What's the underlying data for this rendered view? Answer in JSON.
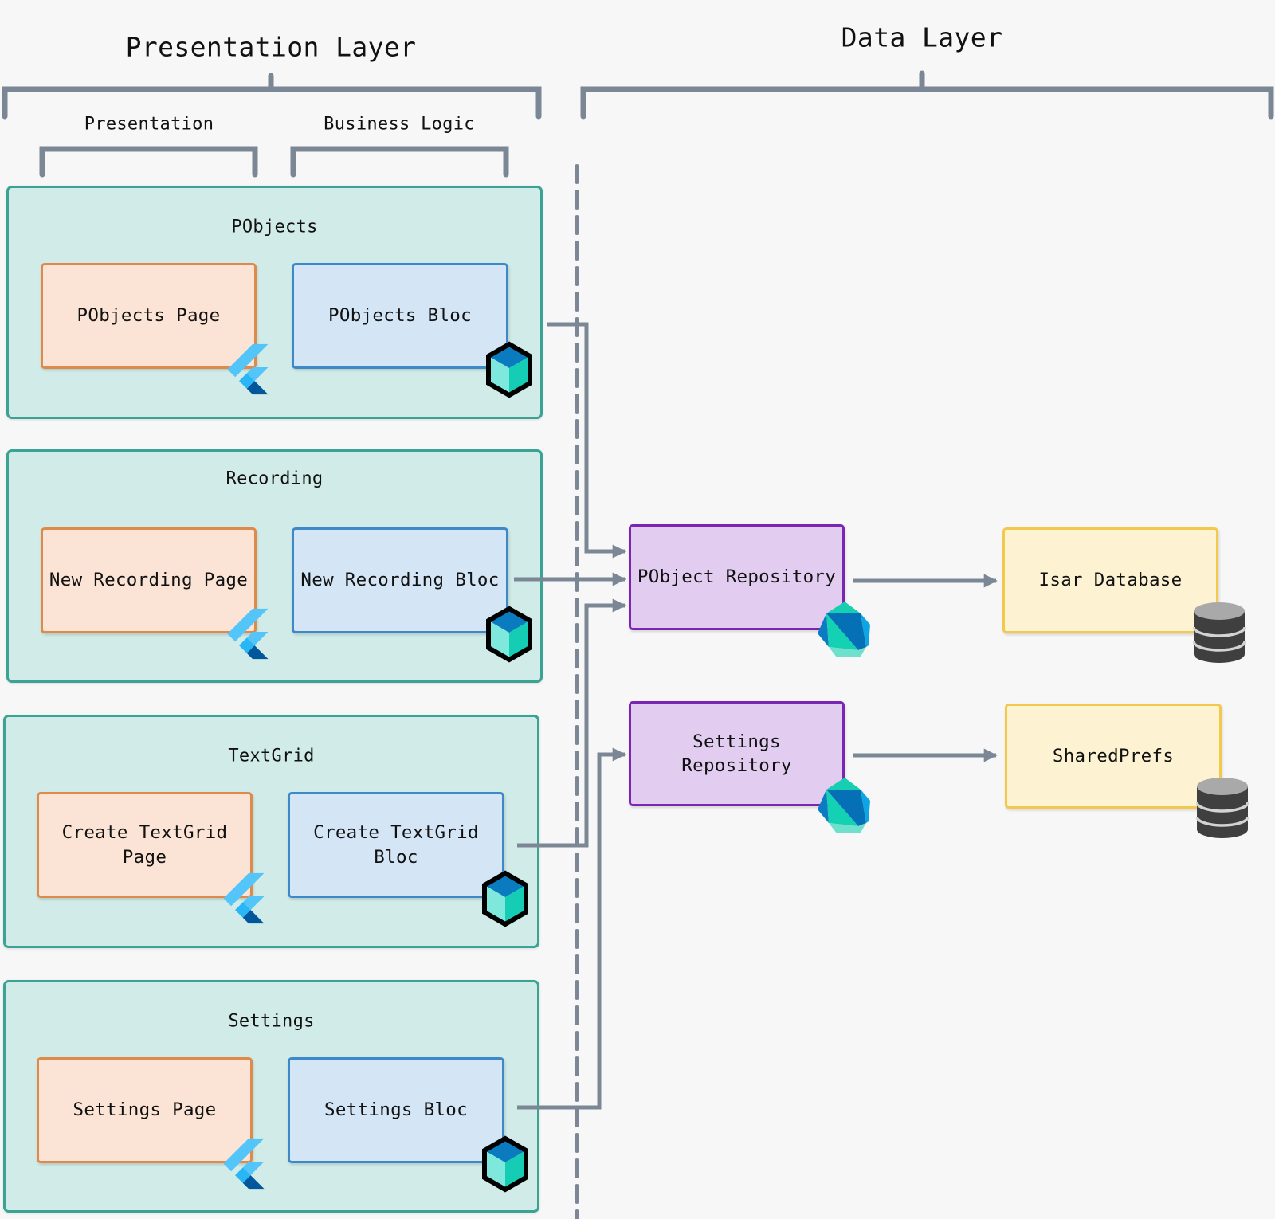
{
  "layers": {
    "presentation_layer": {
      "title": "Presentation Layer",
      "columns": {
        "presentation": "Presentation",
        "business_logic": "Business Logic"
      }
    },
    "data_layer": {
      "title": "Data Layer"
    }
  },
  "features": [
    {
      "title": "PObjects",
      "page": {
        "label": "PObjects Page",
        "icon": "flutter-icon"
      },
      "bloc": {
        "label": "PObjects Bloc",
        "icon": "bloc-cube-icon"
      }
    },
    {
      "title": "Recording",
      "page": {
        "label": "New Recording Page",
        "icon": "flutter-icon"
      },
      "bloc": {
        "label": "New Recording Bloc",
        "icon": "bloc-cube-icon"
      }
    },
    {
      "title": "TextGrid",
      "page": {
        "label": "Create TextGrid\nPage",
        "icon": "flutter-icon"
      },
      "bloc": {
        "label": "Create TextGrid\nBloc",
        "icon": "bloc-cube-icon"
      }
    },
    {
      "title": "Settings",
      "page": {
        "label": "Settings Page",
        "icon": "flutter-icon"
      },
      "bloc": {
        "label": "Settings Bloc",
        "icon": "bloc-cube-icon"
      }
    }
  ],
  "repositories": [
    {
      "label": "PObject Repository",
      "icon": "dart-icon"
    },
    {
      "label": "Settings Repository",
      "icon": "dart-icon"
    }
  ],
  "storage": [
    {
      "label": "Isar Database",
      "icon": "database-icon"
    },
    {
      "label": "SharedPrefs",
      "icon": "database-icon"
    }
  ],
  "connections": [
    {
      "from": "PObjects Bloc",
      "to": "PObject Repository"
    },
    {
      "from": "New Recording Bloc",
      "to": "PObject Repository"
    },
    {
      "from": "Create TextGrid Bloc",
      "to": "PObject Repository"
    },
    {
      "from": "Settings Bloc",
      "to": "Settings Repository"
    },
    {
      "from": "PObject Repository",
      "to": "Isar Database"
    },
    {
      "from": "Settings Repository",
      "to": "SharedPrefs"
    }
  ],
  "colors": {
    "bg": "#f7f7f7",
    "line": "#7b8794",
    "group-bg": "#d1ece8",
    "group-border": "#3aa394",
    "page-bg": "#fbe4d5",
    "page-border": "#dd8a4a",
    "bloc-bg": "#d4e5f6",
    "bloc-border": "#3c88c9",
    "repo-bg": "#e2cdf1",
    "repo-border": "#7b25b3",
    "store-bg": "#fdf2d1",
    "store-border": "#f2c94c",
    "text": "#111111"
  }
}
